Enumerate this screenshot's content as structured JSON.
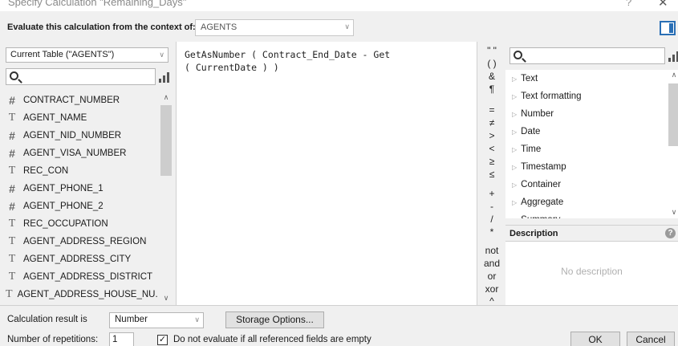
{
  "window": {
    "title": "Specify Calculation \"Remaining_Days\"",
    "help": "?",
    "close": "✕"
  },
  "context": {
    "label": "Evaluate this calculation from the context of:",
    "value": "AGENTS"
  },
  "left": {
    "table_select": "Current Table (\"AGENTS\")",
    "fields": [
      {
        "type": "number",
        "icon": "#",
        "name": "CONTRACT_NUMBER"
      },
      {
        "type": "text",
        "icon": "T",
        "name": "AGENT_NAME"
      },
      {
        "type": "number",
        "icon": "#",
        "name": "AGENT_NID_NUMBER"
      },
      {
        "type": "number",
        "icon": "#",
        "name": "AGENT_VISA_NUMBER"
      },
      {
        "type": "text",
        "icon": "T",
        "name": "REC_CON"
      },
      {
        "type": "number",
        "icon": "#",
        "name": "AGENT_PHONE_1"
      },
      {
        "type": "number",
        "icon": "#",
        "name": "AGENT_PHONE_2"
      },
      {
        "type": "text",
        "icon": "T",
        "name": "REC_OCCUPATION"
      },
      {
        "type": "text",
        "icon": "T",
        "name": "AGENT_ADDRESS_REGION"
      },
      {
        "type": "text",
        "icon": "T",
        "name": "AGENT_ADDRESS_CITY"
      },
      {
        "type": "text",
        "icon": "T",
        "name": "AGENT_ADDRESS_DISTRICT"
      },
      {
        "type": "text",
        "icon": "T",
        "name": "AGENT_ADDRESS_HOUSE_NU..."
      }
    ]
  },
  "editor": {
    "line1": "GetAsNumber ( Contract_End_Date - Get",
    "line2": "( CurrentDate ) )"
  },
  "operators": [
    "\" \"",
    "( )",
    "&",
    "¶",
    "=",
    "≠",
    ">",
    "<",
    "≥",
    "≤",
    "+",
    "-",
    "/",
    "*",
    "not",
    "and",
    "or",
    "xor",
    "^"
  ],
  "functions": {
    "categories": [
      "Text",
      "Text formatting",
      "Number",
      "Date",
      "Time",
      "Timestamp",
      "Container",
      "Aggregate",
      "Summary"
    ]
  },
  "description": {
    "header": "Description",
    "info": "?",
    "empty": "No description"
  },
  "bottom": {
    "result_label": "Calculation result is",
    "result_value": "Number",
    "storage_button": "Storage Options...",
    "repetitions_label": "Number of repetitions:",
    "repetitions_value": "1",
    "checkbox_label": "Do not evaluate if all referenced fields are empty",
    "checkbox_mark": "✓",
    "ok": "OK",
    "cancel": "Cancel"
  }
}
